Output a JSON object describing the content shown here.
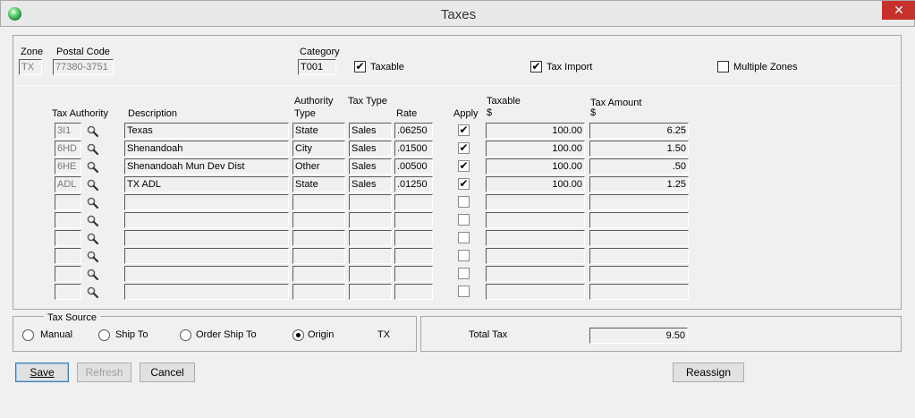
{
  "window": {
    "title": "Taxes",
    "close_glyph": "✕",
    "icon": "app-globe-icon"
  },
  "header": {
    "zone_label": "Zone",
    "zone_value": "TX",
    "postal_label": "Postal Code",
    "postal_value": "77380-3751",
    "category_label": "Category",
    "category_value": "T001",
    "taxable_label": "Taxable",
    "taxable_checked": true,
    "tax_import_label": "Tax Import",
    "tax_import_checked": true,
    "multiple_zones_label": "Multiple Zones",
    "multiple_zones_checked": false
  },
  "grid": {
    "columns": {
      "authority": "Tax Authority",
      "description": "Description",
      "auth_type_1": "Authority",
      "auth_type_2": "Type",
      "tax_type": "Tax Type",
      "rate": "Rate",
      "apply": "Apply",
      "taxable_1": "Taxable",
      "taxable_2": "$",
      "amount_1": "Tax Amount",
      "amount_2": "$"
    },
    "rows": [
      {
        "authority": "3I1",
        "description": "Texas",
        "auth_type": "State",
        "tax_type": "Sales",
        "rate": ".06250",
        "apply": true,
        "taxable": "100.00",
        "amount": "6.25"
      },
      {
        "authority": "6HD",
        "description": "Shenandoah",
        "auth_type": "City",
        "tax_type": "Sales",
        "rate": ".01500",
        "apply": true,
        "taxable": "100.00",
        "amount": "1.50"
      },
      {
        "authority": "6HE",
        "description": "Shenandoah Mun Dev Dist",
        "auth_type": "Other",
        "tax_type": "Sales",
        "rate": ".00500",
        "apply": true,
        "taxable": "100.00",
        "amount": ".50"
      },
      {
        "authority": "ADL",
        "description": "TX ADL",
        "auth_type": "State",
        "tax_type": "Sales",
        "rate": ".01250",
        "apply": true,
        "taxable": "100.00",
        "amount": "1.25"
      },
      {
        "authority": "",
        "description": "",
        "auth_type": "",
        "tax_type": "",
        "rate": "",
        "apply": false,
        "taxable": "",
        "amount": ""
      },
      {
        "authority": "",
        "description": "",
        "auth_type": "",
        "tax_type": "",
        "rate": "",
        "apply": false,
        "taxable": "",
        "amount": ""
      },
      {
        "authority": "",
        "description": "",
        "auth_type": "",
        "tax_type": "",
        "rate": "",
        "apply": false,
        "taxable": "",
        "amount": ""
      },
      {
        "authority": "",
        "description": "",
        "auth_type": "",
        "tax_type": "",
        "rate": "",
        "apply": false,
        "taxable": "",
        "amount": ""
      },
      {
        "authority": "",
        "description": "",
        "auth_type": "",
        "tax_type": "",
        "rate": "",
        "apply": false,
        "taxable": "",
        "amount": ""
      },
      {
        "authority": "",
        "description": "",
        "auth_type": "",
        "tax_type": "",
        "rate": "",
        "apply": false,
        "taxable": "",
        "amount": ""
      }
    ],
    "lookup_icon": "magnifier-icon",
    "check_glyph": "✔"
  },
  "tax_source": {
    "title": "Tax Source",
    "options": [
      {
        "label": "Manual",
        "selected": false
      },
      {
        "label": "Ship To",
        "selected": false
      },
      {
        "label": "Order Ship To",
        "selected": false
      },
      {
        "label": "Origin",
        "selected": true
      }
    ],
    "origin_zone": "TX"
  },
  "total": {
    "label": "Total Tax",
    "value": "9.50"
  },
  "buttons": {
    "save": "Save",
    "refresh": "Refresh",
    "cancel": "Cancel",
    "reassign": "Reassign"
  }
}
